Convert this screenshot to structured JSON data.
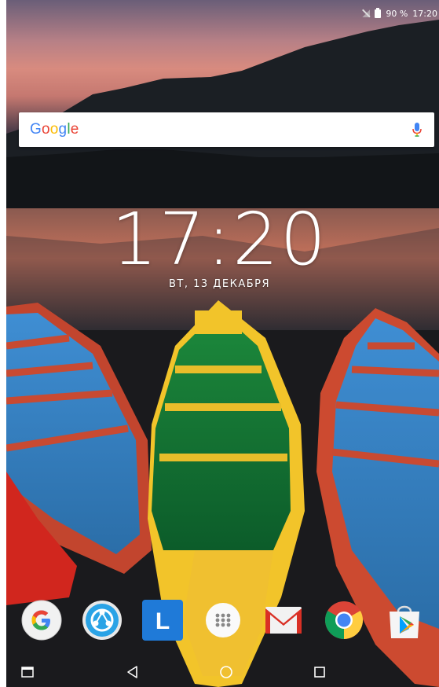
{
  "status_bar": {
    "battery": "90 %",
    "time": "17:20"
  },
  "search": {
    "logo_letters": [
      "G",
      "o",
      "o",
      "g",
      "l",
      "e"
    ],
    "logo_colors": [
      "#4285F4",
      "#EA4335",
      "#FBBC05",
      "#4285F4",
      "#34A853",
      "#EA4335"
    ]
  },
  "clock": {
    "time": "17:20",
    "date": "ВТ, 13 ДЕКАБРЯ"
  },
  "dock": {
    "apps": [
      {
        "name": "google-app",
        "icon": "google-g-icon"
      },
      {
        "name": "shareit-app",
        "icon": "shareit-icon"
      },
      {
        "name": "launcher-l-app",
        "icon": "l-letter-icon",
        "letter": "L"
      },
      {
        "name": "app-drawer",
        "icon": "app-drawer-icon"
      },
      {
        "name": "gmail-app",
        "icon": "gmail-icon"
      },
      {
        "name": "chrome-app",
        "icon": "chrome-icon"
      },
      {
        "name": "play-store-app",
        "icon": "play-store-icon"
      }
    ]
  },
  "nav": {
    "buttons": [
      "recent-apps-alt-icon",
      "back-icon",
      "home-icon",
      "overview-icon"
    ]
  },
  "colors": {
    "accent_blue": "#4285F4",
    "red": "#EA4335",
    "yellow": "#FBBC05",
    "green": "#34A853"
  }
}
